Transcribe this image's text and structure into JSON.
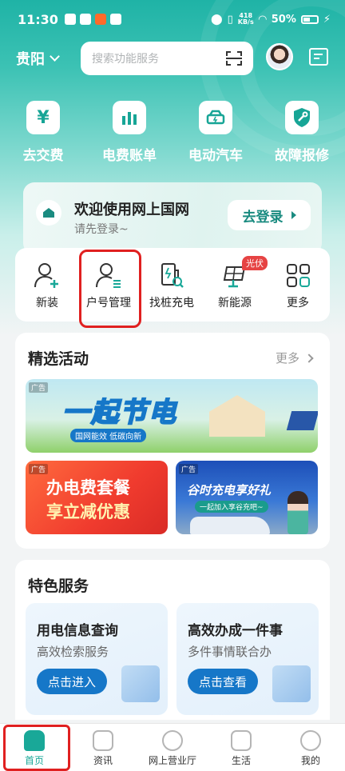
{
  "status_bar": {
    "time": "11:30",
    "net_speed_value": "418",
    "net_speed_unit": "KB/s",
    "battery": "50%"
  },
  "header": {
    "city": "贵阳",
    "search_placeholder": "搜索功能服务"
  },
  "quick_actions": [
    {
      "label": "去交费",
      "icon": "yuan-icon"
    },
    {
      "label": "电费账单",
      "icon": "bar-chart-icon"
    },
    {
      "label": "电动汽车",
      "icon": "ev-charger-icon"
    },
    {
      "label": "故障报修",
      "icon": "repair-shield-icon"
    }
  ],
  "login_card": {
    "title": "欢迎使用网上国网",
    "subtitle": "请先登录~",
    "button": "去登录"
  },
  "services": [
    {
      "label": "新装",
      "icon": "user-add-icon"
    },
    {
      "label": "户号管理",
      "icon": "user-list-icon"
    },
    {
      "label": "找桩充电",
      "icon": "find-charger-icon"
    },
    {
      "label": "新能源",
      "icon": "solar-panel-icon",
      "badge": "光伏"
    },
    {
      "label": "更多",
      "icon": "grid-icon"
    }
  ],
  "activities": {
    "title": "精选活动",
    "more": "更多",
    "ad_label": "广告",
    "banner_main_text": "一起节电",
    "banner_main_sub": "国网能效 低碳向新",
    "banner_left_line1": "办电费套餐",
    "banner_left_line2": "享立减优惠",
    "banner_right_line1": "谷时充电享好礼",
    "banner_right_line2": "一起加入享谷充吧~"
  },
  "featured": {
    "title": "特色服务",
    "cards": [
      {
        "title": "用电信息查询",
        "subtitle": "高效检索服务",
        "button": "点击进入"
      },
      {
        "title": "高效办成一件事",
        "subtitle": "多件事情联合办",
        "button": "点击查看"
      }
    ]
  },
  "bottom_nav": [
    {
      "label": "首页",
      "active": true
    },
    {
      "label": "资讯"
    },
    {
      "label": "网上营业厅"
    },
    {
      "label": "生活"
    },
    {
      "label": "我的"
    }
  ],
  "colors": {
    "brand": "#19a898",
    "highlight_box": "#e02020"
  }
}
